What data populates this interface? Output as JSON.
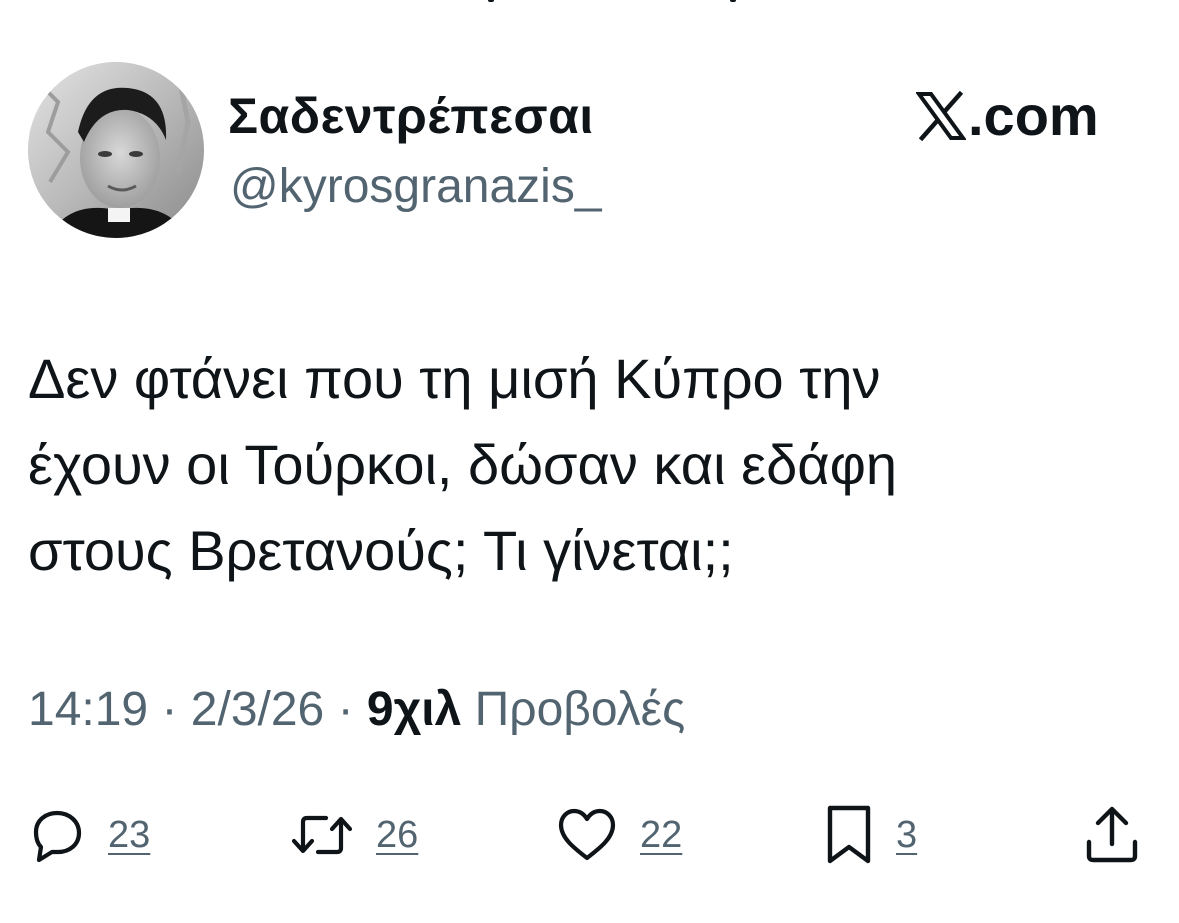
{
  "author": {
    "display_name": "Σαδεντρέπεσαι",
    "handle": "@kyrosgranazis_"
  },
  "brand": {
    "label": ".com",
    "icon": "x-logo-icon"
  },
  "tweet": {
    "lines": [
      "Δεν φτάνει που τη μισή Κύπρο την",
      "έχουν οι Τούρκοι, δώσαν και εδάφη",
      "στους Βρετανούς; Τι γίνεται;;"
    ]
  },
  "meta": {
    "time": "14:19",
    "separator": "·",
    "date": "2/3/26",
    "views_count": "9χιλ",
    "views_label": "Προβολές"
  },
  "actions": {
    "replies": {
      "icon": "reply-icon",
      "count": "23"
    },
    "reposts": {
      "icon": "repost-icon",
      "count": "26"
    },
    "likes": {
      "icon": "heart-icon",
      "count": "22"
    },
    "bookmarks": {
      "icon": "bookmark-icon",
      "count": "3"
    },
    "share": {
      "icon": "share-icon"
    }
  },
  "colors": {
    "text_primary": "#0f1419",
    "text_secondary": "#536471",
    "background": "#ffffff"
  }
}
